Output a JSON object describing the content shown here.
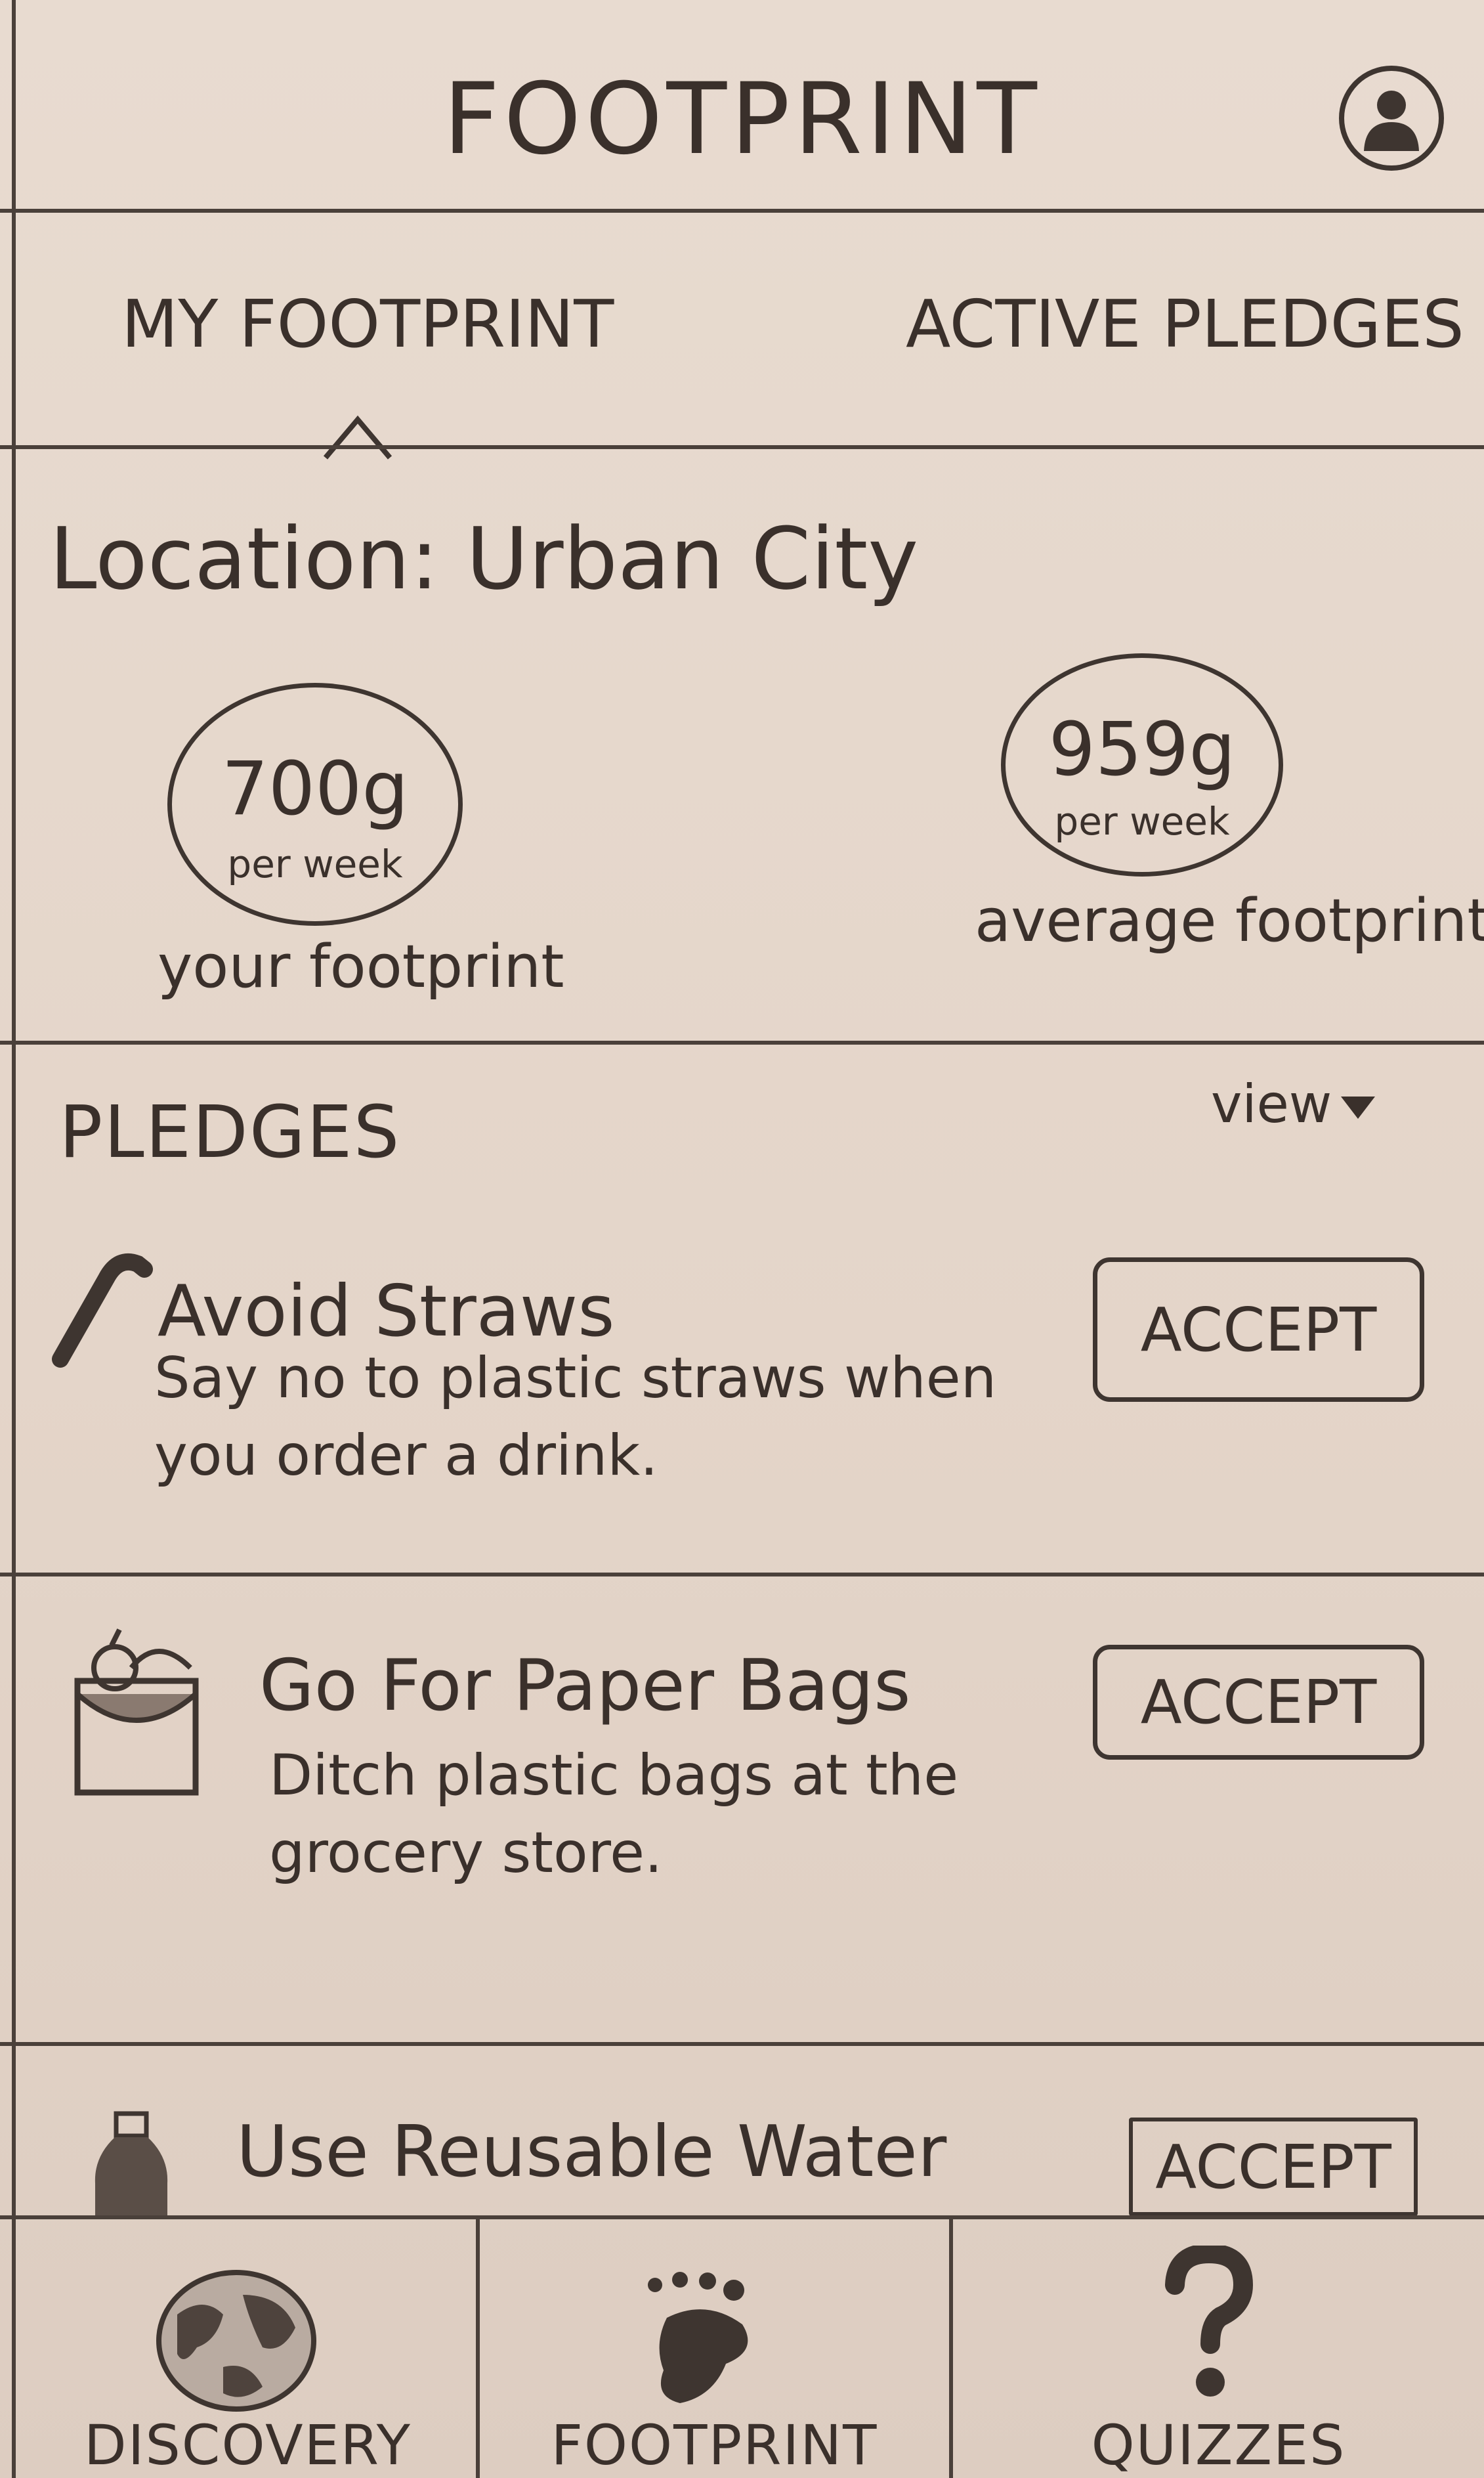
{
  "header": {
    "title": "FOOTPRINT"
  },
  "tabs": [
    {
      "label": "MY FOOTPRINT",
      "active": true
    },
    {
      "label": "ACTIVE PLEDGES",
      "active": false
    }
  ],
  "footprint": {
    "location_label": "Location: Urban City",
    "yours": {
      "value": "700g",
      "unit": "per week",
      "caption": "your footprint"
    },
    "average": {
      "value": "959g",
      "unit": "per week",
      "caption": "average footprint"
    }
  },
  "pledges": {
    "section_title": "PLEDGES",
    "view_label": "view",
    "items": [
      {
        "title": "Avoid Straws",
        "description": "Say no to plastic straws when you order a drink.",
        "action": "ACCEPT",
        "icon": "straw-icon"
      },
      {
        "title": "Go For Paper Bags",
        "description": "Ditch plastic bags at the grocery store.",
        "action": "ACCEPT",
        "icon": "grocery-bag-icon"
      },
      {
        "title": "Use Reusable Water",
        "description": "",
        "action": "ACCEPT",
        "icon": "water-bottle-icon"
      }
    ]
  },
  "bottom_nav": [
    {
      "label": "DISCOVERY",
      "icon": "globe-icon"
    },
    {
      "label": "FOOTPRINT",
      "icon": "footprint-icon"
    },
    {
      "label": "QUIZZES",
      "icon": "question-mark-icon"
    }
  ]
}
